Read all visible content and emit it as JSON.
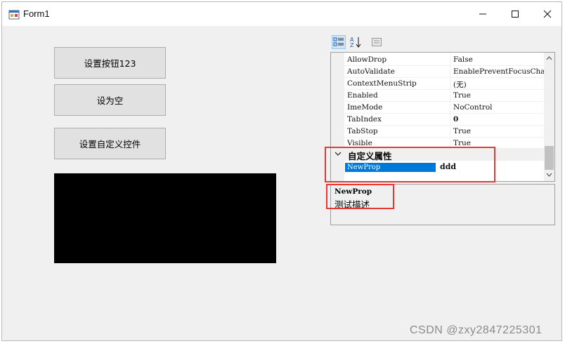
{
  "window": {
    "title": "Form1",
    "controls": {
      "minimize_icon": "minimize-icon",
      "maximize_icon": "maximize-icon",
      "close_icon": "close-icon"
    }
  },
  "buttons": {
    "set_button": "设置按钮123",
    "set_empty": "设为空",
    "set_custom_control": "设置自定义控件"
  },
  "property_grid": {
    "toolbar": {
      "categorized_icon": "categorized-view-icon",
      "alphabetical_icon": "alphabetical-sort-icon",
      "property_pages_icon": "property-pages-icon"
    },
    "rows": [
      {
        "name": "AllowDrop",
        "value": "False"
      },
      {
        "name": "AutoValidate",
        "value": "EnablePreventFocusChange"
      },
      {
        "name": "ContextMenuStrip",
        "value": "(无)"
      },
      {
        "name": "Enabled",
        "value": "True"
      },
      {
        "name": "ImeMode",
        "value": "NoControl"
      },
      {
        "name": "TabIndex",
        "value": "0"
      },
      {
        "name": "TabStop",
        "value": "True"
      },
      {
        "name": "Visible",
        "value": "True"
      }
    ],
    "category": {
      "label": "自定义属性"
    },
    "selected_row": {
      "name": "NewProp",
      "value": "ddd"
    },
    "help": {
      "title": "NewProp",
      "description": "测试描述"
    }
  },
  "colors": {
    "selection": "#0078d7",
    "highlight_border": "#e53935",
    "window_bg": "#f0f0f0"
  },
  "watermark": "CSDN @zxy2847225301"
}
